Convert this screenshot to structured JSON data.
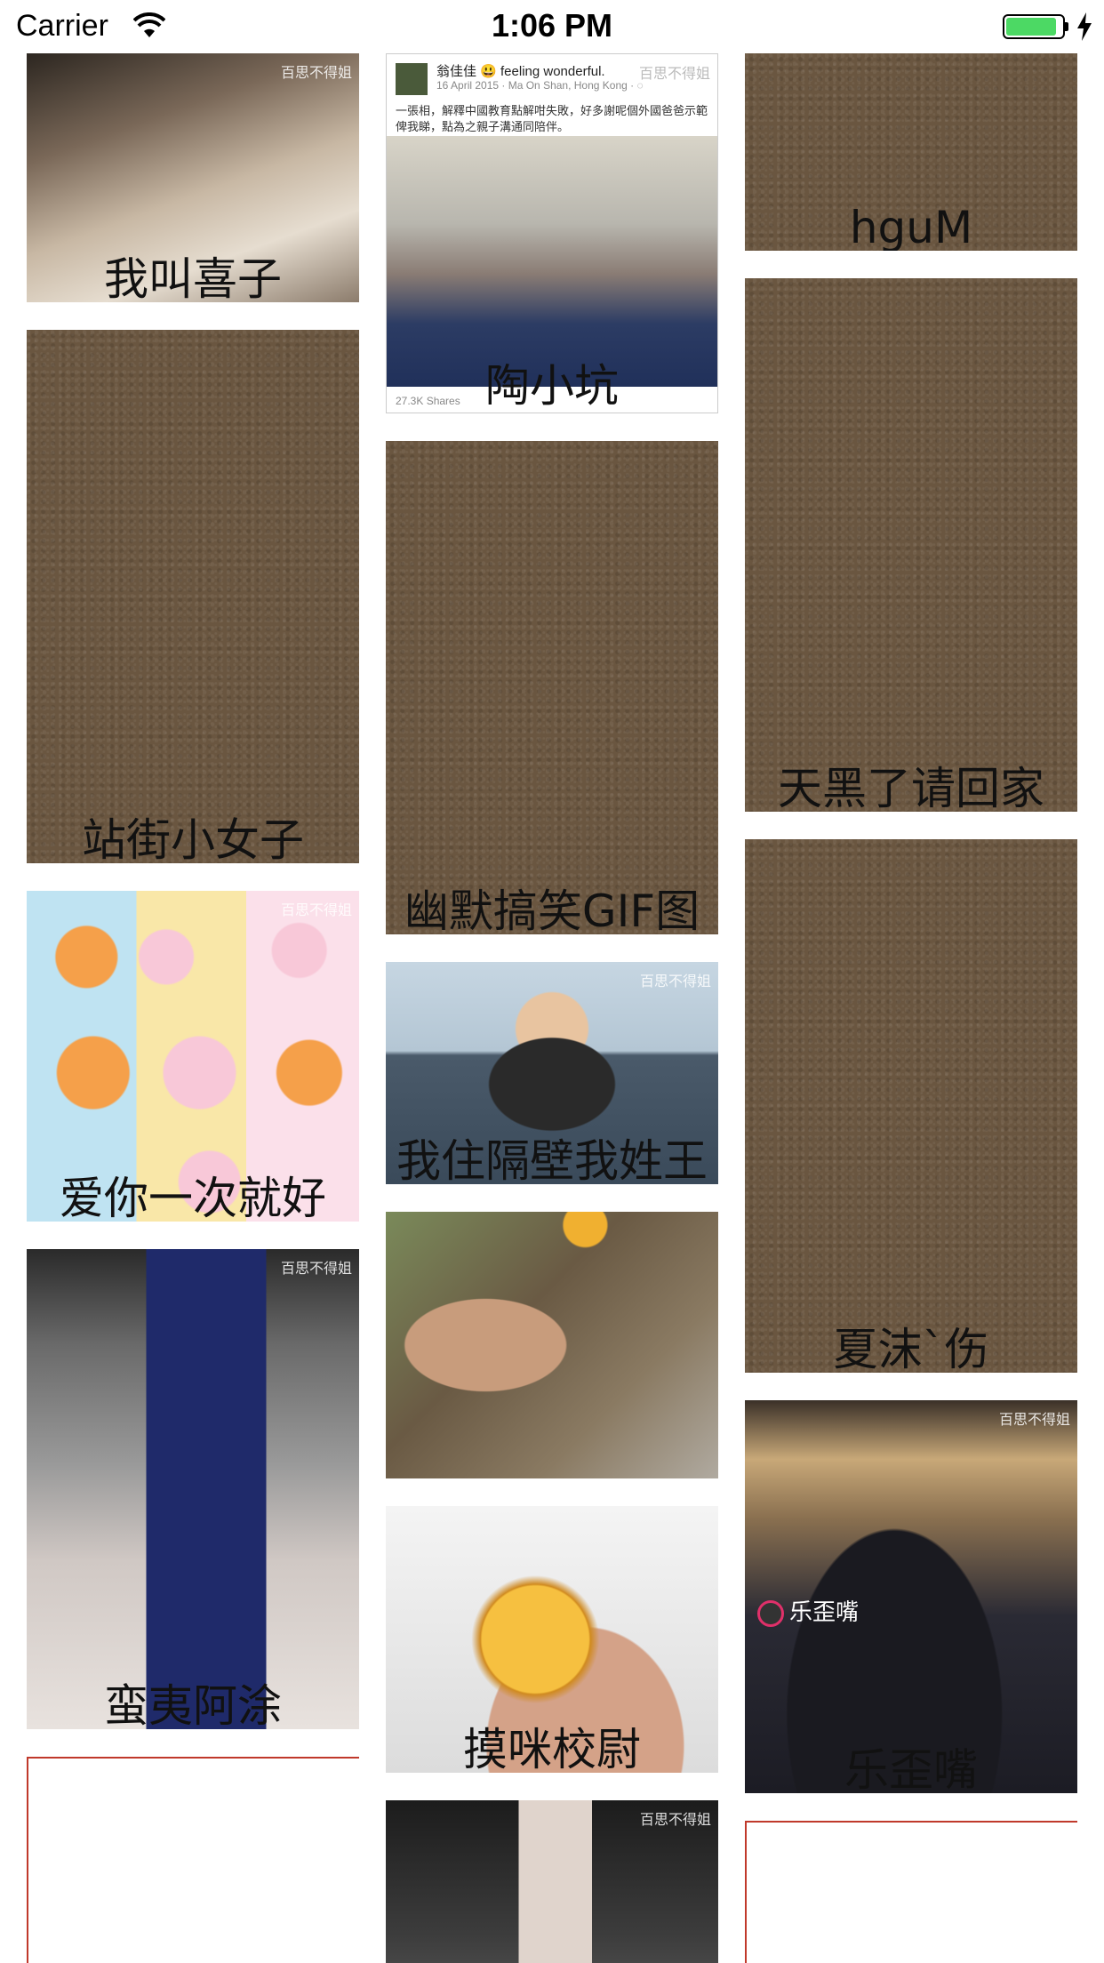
{
  "status_bar": {
    "carrier": "Carrier",
    "time": "1:06 PM",
    "battery_level": 0.9,
    "battery_color": "#4cd964"
  },
  "feed": {
    "columns": [
      {
        "cards": [
          {
            "caption": "我叫喜子",
            "image": "photo",
            "watermark": "百思不得姐"
          },
          {
            "caption": "站街小女子",
            "image": "placeholder"
          },
          {
            "caption": "爱你一次就好",
            "image": "photo",
            "watermark": "百思不得姐"
          },
          {
            "caption": "蛮夷阿涂",
            "image": "photo",
            "watermark": "百思不得姐"
          },
          {
            "caption": "",
            "image": "empty"
          }
        ]
      },
      {
        "cards": [
          {
            "caption": "陶小坑",
            "image": "facebook-post",
            "watermark": "百思不得姐",
            "post": {
              "name": "翁佳佳 😃 feeling wonderful.",
              "meta": "16 April 2015 · Ma On Shan, Hong Kong · ◌",
              "text": "一張相，解釋中國教育點解咁失敗，好多謝呢個外國爸爸示範俾我睇，點為之親子溝通同陪伴。",
              "shares": "27.3K Shares"
            }
          },
          {
            "caption": "幽默搞笑GIF图",
            "image": "placeholder"
          },
          {
            "caption": "我住隔壁我姓王",
            "image": "photo",
            "watermark": "百思不得姐"
          },
          {
            "caption": "",
            "image": "photo"
          },
          {
            "caption": "摸咪校尉",
            "image": "photo"
          },
          {
            "caption": "",
            "image": "photo",
            "watermark": "百思不得姐"
          }
        ]
      },
      {
        "cards": [
          {
            "caption": "hguM",
            "image": "placeholder"
          },
          {
            "caption": "天黑了请回家",
            "image": "placeholder"
          },
          {
            "caption": "夏沫`伤",
            "image": "placeholder"
          },
          {
            "caption": "乐歪嘴",
            "image": "photo",
            "watermark": "百思不得姐",
            "badge": "乐歪嘴"
          },
          {
            "caption": "",
            "image": "empty"
          }
        ]
      }
    ]
  }
}
